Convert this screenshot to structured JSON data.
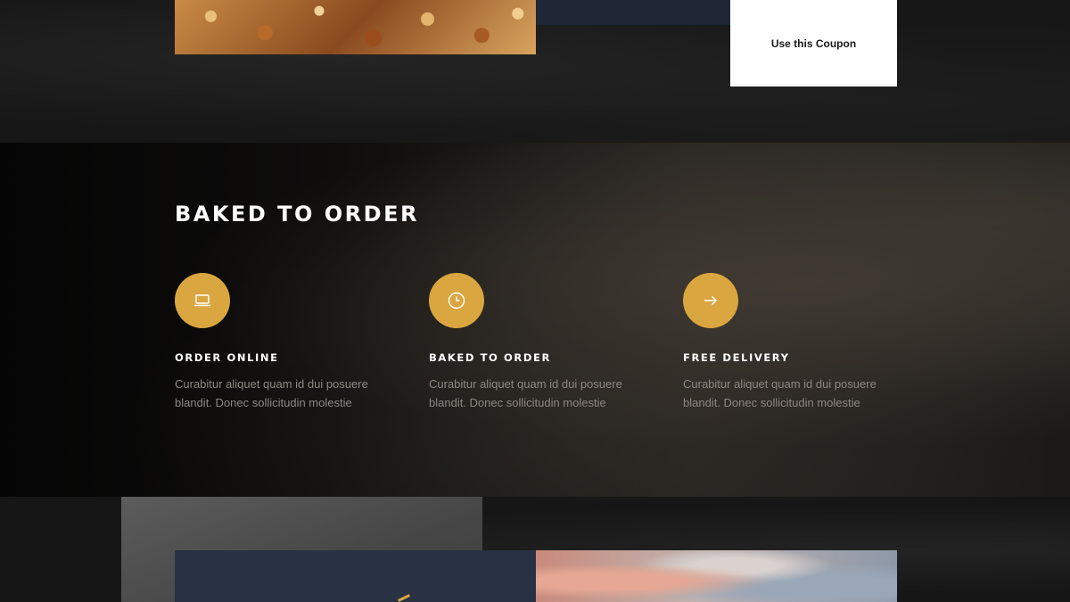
{
  "colors": {
    "accent_gold": "#d9a640",
    "navy": "#283242",
    "background": "#141414"
  },
  "coupon": {
    "button_label": "Use this Coupon"
  },
  "features": {
    "heading": "BAKED TO ORDER",
    "items": [
      {
        "icon": "laptop-icon",
        "title": "ORDER ONLINE",
        "text": "Curabitur aliquet quam id dui posuere blandit. Donec sollicitudin molestie"
      },
      {
        "icon": "clock-icon",
        "title": "BAKED TO ORDER",
        "text": "Curabitur aliquet quam id dui posuere blandit. Donec sollicitudin molestie"
      },
      {
        "icon": "arrow-right-icon",
        "title": "FREE DELIVERY",
        "text": "Curabitur aliquet quam id dui posuere blandit. Donec sollicitudin molestie"
      }
    ]
  }
}
